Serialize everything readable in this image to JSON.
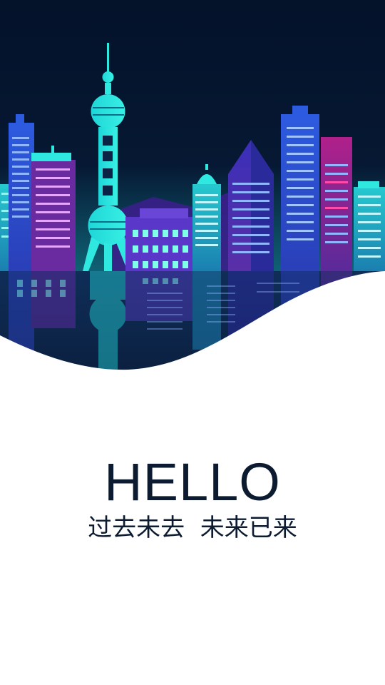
{
  "splash": {
    "headline": "HELLO",
    "tagline": "过去未去  未来已来"
  },
  "colors": {
    "sky": "#05132a",
    "cyan": "#2fe8e0",
    "blue": "#2b4fd6",
    "purple": "#4a2aa8",
    "magenta": "#a0207a",
    "text": "#0d1b30",
    "background": "#ffffff"
  },
  "illustration": {
    "subject": "night-city-skyline-with-tv-tower"
  }
}
